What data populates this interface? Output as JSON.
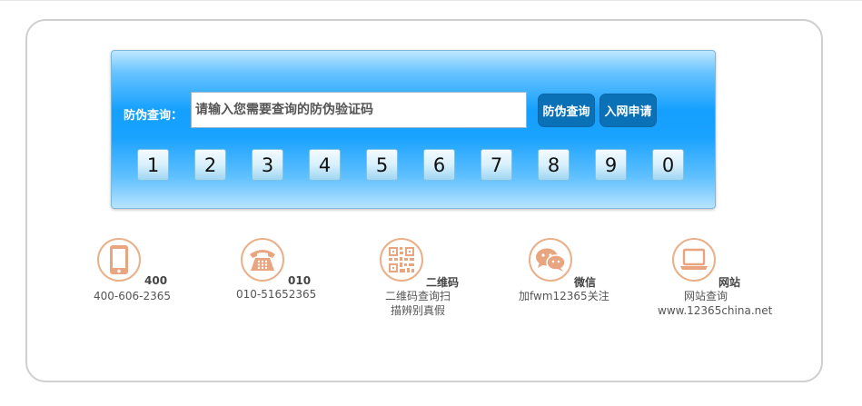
{
  "search": {
    "label": "防伪查询：",
    "placeholder": "请输入您需要查询的防伪验证码",
    "query_button": "防伪查询",
    "apply_button": "入网申请"
  },
  "keypad": [
    "1",
    "2",
    "3",
    "4",
    "5",
    "6",
    "7",
    "8",
    "9",
    "0"
  ],
  "contacts": [
    {
      "icon": "phone-icon",
      "title": "400",
      "lines": [
        "400-606-2365"
      ]
    },
    {
      "icon": "telephone-icon",
      "title": "010",
      "lines": [
        "010-51652365"
      ]
    },
    {
      "icon": "qrcode-icon",
      "title": "二维码",
      "lines": [
        "二维码查询扫",
        "描辨别真假"
      ]
    },
    {
      "icon": "wechat-icon",
      "title": "微信",
      "lines": [
        "加fwm12365关注"
      ]
    },
    {
      "icon": "website-icon",
      "title": "网站",
      "lines": [
        "网站查询",
        "www.12365china.net"
      ]
    }
  ],
  "colors": {
    "panel_blue": "#1aa2ff",
    "button_blue": "#0b71b7",
    "icon_orange": "#e9a57f"
  }
}
